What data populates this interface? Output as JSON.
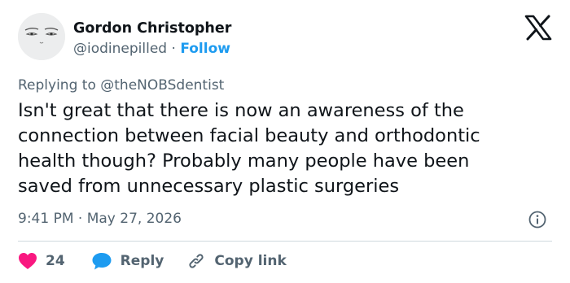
{
  "author": {
    "display_name": "Gordon Christopher",
    "handle": "@iodinepilled",
    "separator": "·",
    "follow_label": "Follow"
  },
  "reply_context": {
    "prefix": "Replying to",
    "mention": "@theNOBSdentist"
  },
  "tweet": {
    "lines": [
      "Isn't great that there is now an awareness of the",
      "connection between facial beauty and orthodontic",
      "health though?  Probably many people have been",
      "saved from unnecessary plastic surgeries"
    ]
  },
  "meta": {
    "time": "9:41 PM",
    "separator": "·",
    "date": "May 27, 2026"
  },
  "actions": {
    "like_count": "24",
    "reply_label": "Reply",
    "copy_link_label": "Copy link"
  },
  "colors": {
    "like": "#f91880",
    "reply": "#1d9bf0",
    "link": "#1d9bf0",
    "muted": "#536471"
  },
  "icons": {
    "avatar": "face-avatar",
    "logo": "x-logo-icon",
    "info": "info-icon",
    "like": "heart-icon",
    "reply": "speech-bubble-icon",
    "copy_link": "link-icon"
  }
}
